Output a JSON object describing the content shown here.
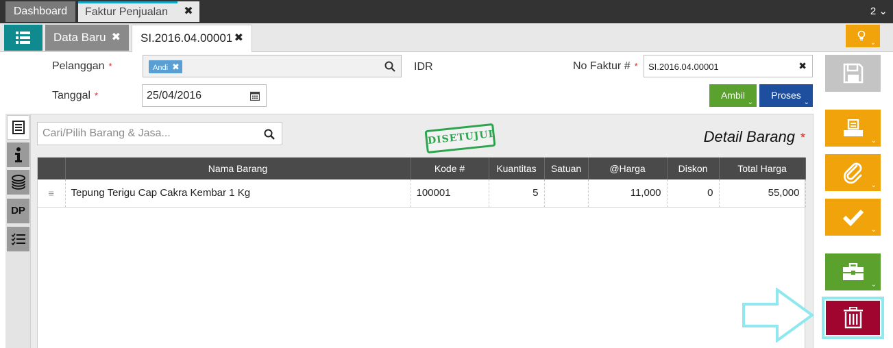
{
  "window_tabs": [
    {
      "label": "Dashboard"
    },
    {
      "label": "Faktur Penjualan"
    }
  ],
  "window_count": "2",
  "window_count_caret": "⌄",
  "sub_tabs": [
    {
      "label": "Data Baru"
    },
    {
      "label": "SI.2016.04.00001"
    }
  ],
  "close_glyph": "✖",
  "form": {
    "pelanggan_label": "Pelanggan",
    "pelanggan_chip": "Andi",
    "currency": "IDR",
    "tanggal_label": "Tanggal",
    "tanggal_value": "25/04/2016",
    "no_faktur_label": "No Faktur #",
    "no_faktur_value": "SI.2016.04.00001",
    "required_mark": "*"
  },
  "buttons": {
    "ambil": "Ambil",
    "proses": "Proses",
    "caret": "⌄"
  },
  "detail": {
    "search_placeholder": "Cari/Pilih Barang & Jasa...",
    "stamp": "DISETUJUI",
    "title": "Detail Barang",
    "side_dp": "DP"
  },
  "table": {
    "headers": [
      "Nama Barang",
      "Kode #",
      "Kuantitas",
      "Satuan",
      "@Harga",
      "Diskon",
      "Total Harga"
    ],
    "rows": [
      {
        "handle": "≡",
        "nama": "Tepung Terigu Cap Cakra Kembar 1 Kg",
        "kode": "100001",
        "kuantitas": "5",
        "satuan": "",
        "harga": "11,000",
        "diskon": "0",
        "total": "55,000"
      }
    ]
  },
  "colors": {
    "accent_teal": "#0f8a8e",
    "orange": "#f0a30a",
    "green": "#5aa12e",
    "blue": "#1d4f9e",
    "delete_red": "#a0052f",
    "highlight_cyan": "#8ee8ee"
  },
  "icons": {
    "menu": "list-icon",
    "tip": "lightbulb-icon",
    "save": "save-icon",
    "print": "print-icon",
    "attach": "paperclip-icon",
    "approve": "check-icon",
    "tools": "briefcase-icon",
    "delete": "trash-icon",
    "search": "search-icon",
    "calendar": "calendar-icon"
  }
}
